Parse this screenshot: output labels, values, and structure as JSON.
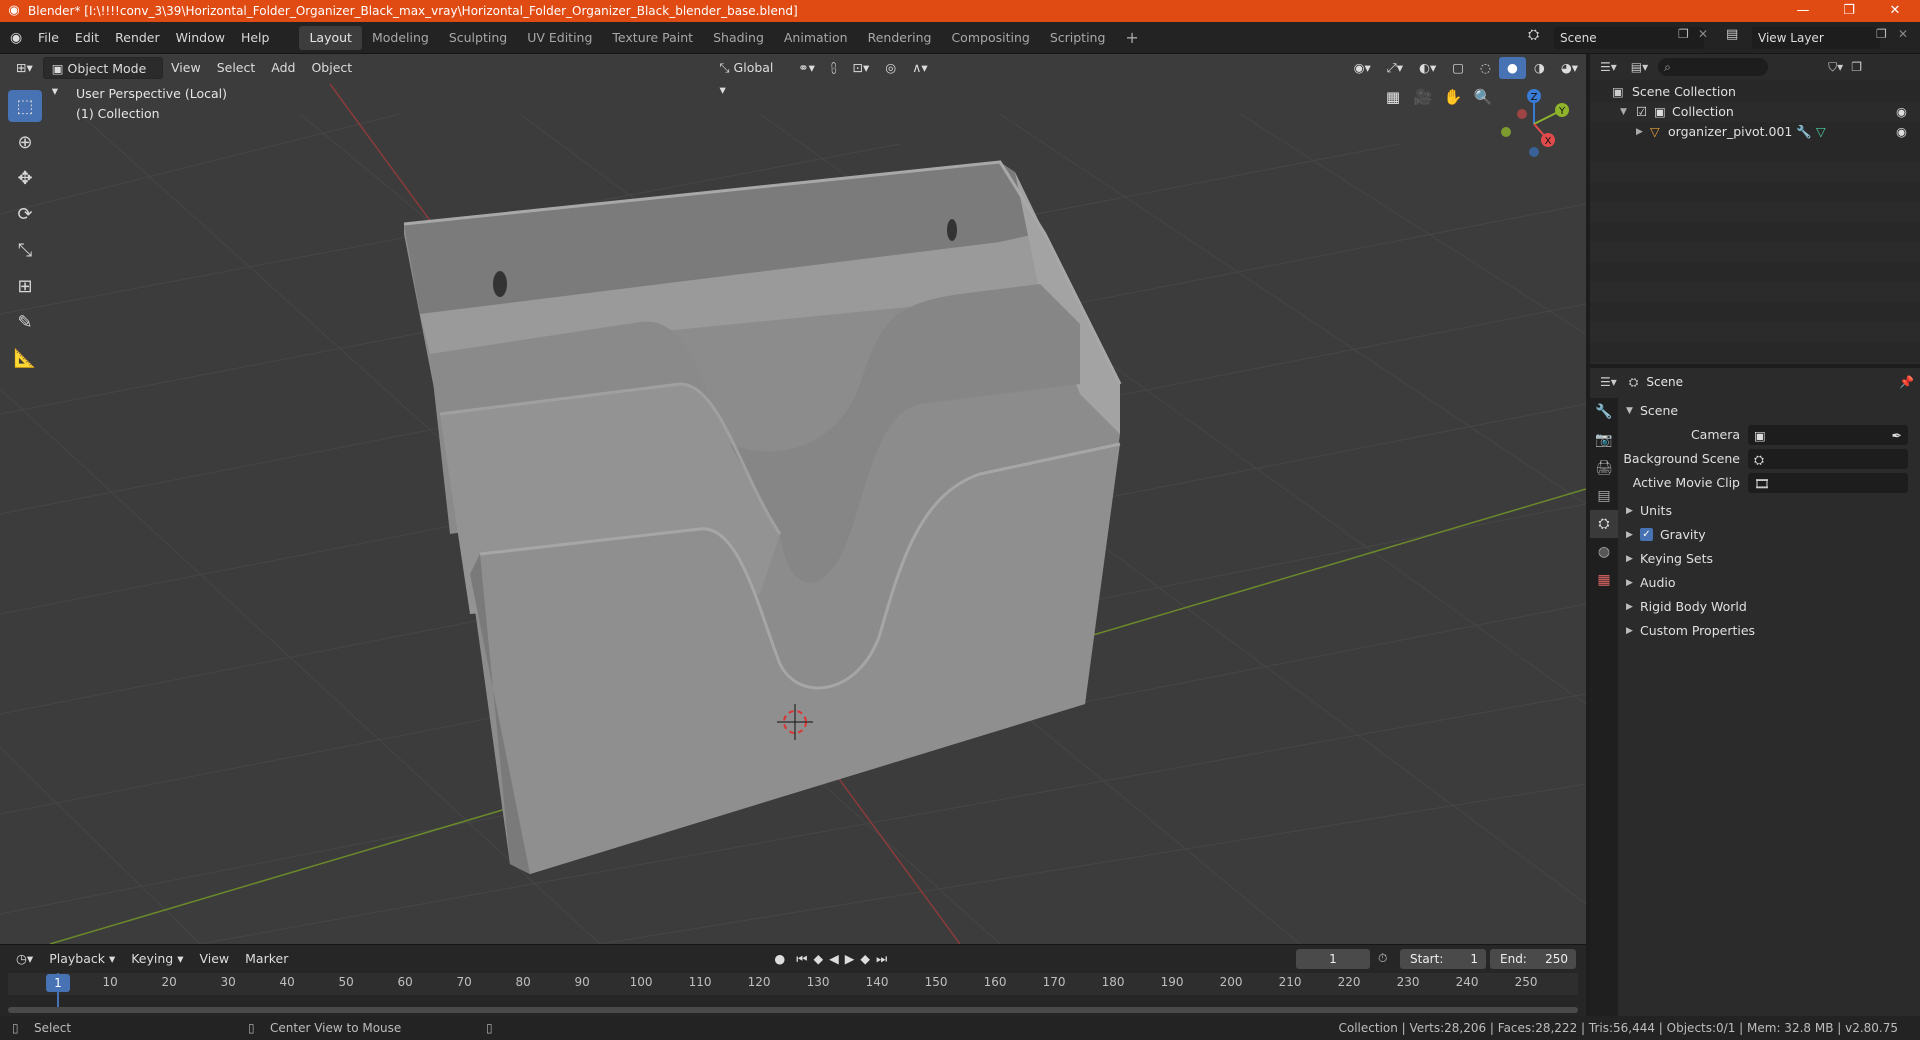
{
  "window": {
    "title": "Blender* [I:\\!!!!conv_3\\39\\Horizontal_Folder_Organizer_Black_max_vray\\Horizontal_Folder_Organizer_Black_blender_base.blend]",
    "minimize_icon": "minimize-icon",
    "maximize_icon": "restore-icon",
    "close_icon": "close-icon"
  },
  "menu": [
    "File",
    "Edit",
    "Render",
    "Window",
    "Help"
  ],
  "workspaces": {
    "tabs": [
      "Layout",
      "Modeling",
      "Sculpting",
      "UV Editing",
      "Texture Paint",
      "Shading",
      "Animation",
      "Rendering",
      "Compositing",
      "Scripting"
    ],
    "active": "Layout",
    "add_icon": "plus-icon"
  },
  "scene_selector": {
    "value": "Scene"
  },
  "view_layer_selector": {
    "value": "View Layer"
  },
  "viewport": {
    "mode": "Object Mode",
    "menus": [
      "View",
      "Select",
      "Add",
      "Object"
    ],
    "transform_orientation": "Global",
    "info_line1": "User Perspective (Local)",
    "info_line2": "(1) Collection",
    "gizmo": {
      "x": "X",
      "y": "Y",
      "z": "Z"
    },
    "tools": [
      "select-box-icon",
      "cursor-icon",
      "move-icon",
      "rotate-icon",
      "scale-icon",
      "transform-icon",
      "annotate-icon",
      "measure-icon"
    ]
  },
  "outliner": {
    "root": "Scene Collection",
    "collection": "Collection",
    "object": "organizer_pivot.001"
  },
  "properties": {
    "header": "Scene",
    "panel": "Scene",
    "camera_label": "Camera",
    "background_scene_label": "Background Scene",
    "active_movie_clip_label": "Active Movie Clip",
    "subpanels": [
      "Units",
      "Gravity",
      "Keying Sets",
      "Audio",
      "Rigid Body World",
      "Custom Properties"
    ],
    "gravity_checked": true
  },
  "timeline": {
    "menus": [
      "Playback",
      "Keying",
      "View",
      "Marker"
    ],
    "current_frame": "1",
    "start_label": "Start:",
    "start_value": "1",
    "end_label": "End:",
    "end_value": "250",
    "ticks": [
      "10",
      "20",
      "30",
      "40",
      "50",
      "60",
      "70",
      "80",
      "90",
      "100",
      "110",
      "120",
      "130",
      "140",
      "150",
      "160",
      "170",
      "180",
      "190",
      "200",
      "210",
      "220",
      "230",
      "240",
      "250"
    ],
    "playhead": "1"
  },
  "statusbar": {
    "left1": "Select",
    "left2": "Center View to Mouse",
    "right": "Collection | Verts:28,206 | Faces:28,222 | Tris:56,444 | Objects:0/1 | Mem: 32.8 MB | v2.80.75"
  }
}
